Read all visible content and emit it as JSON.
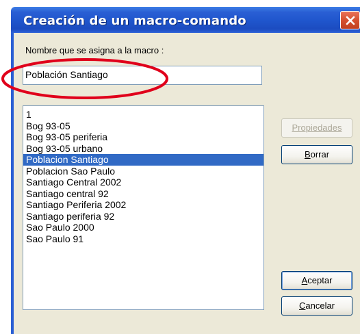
{
  "window": {
    "title": "Creación de un macro-comando",
    "close_icon": "close-icon"
  },
  "form": {
    "name_label": "Nombre que se asigna a la macro :",
    "name_value": "Población Santiago"
  },
  "macro_list": {
    "items": [
      "1",
      "Bog 93-05",
      "Bog 93-05 periferia",
      "Bog 93-05 urbano",
      "Poblacion Santiago",
      "Poblacion Sao Paulo",
      "Santiago Central 2002",
      "Santiago central 92",
      "Santiago Periferia 2002",
      "Santiago periferia 92",
      "Sao Paulo 2000",
      "Sao Paulo 91"
    ],
    "selected_index": 4
  },
  "buttons": {
    "properties": "Propiedades",
    "delete": "Borrar",
    "accept": "Aceptar",
    "cancel": "Cancelar"
  },
  "colors": {
    "titlebar": "#1f55cc",
    "selection": "#316ac5",
    "annotation_circle": "#e0001b",
    "dialog_bg": "#ece9d8"
  }
}
